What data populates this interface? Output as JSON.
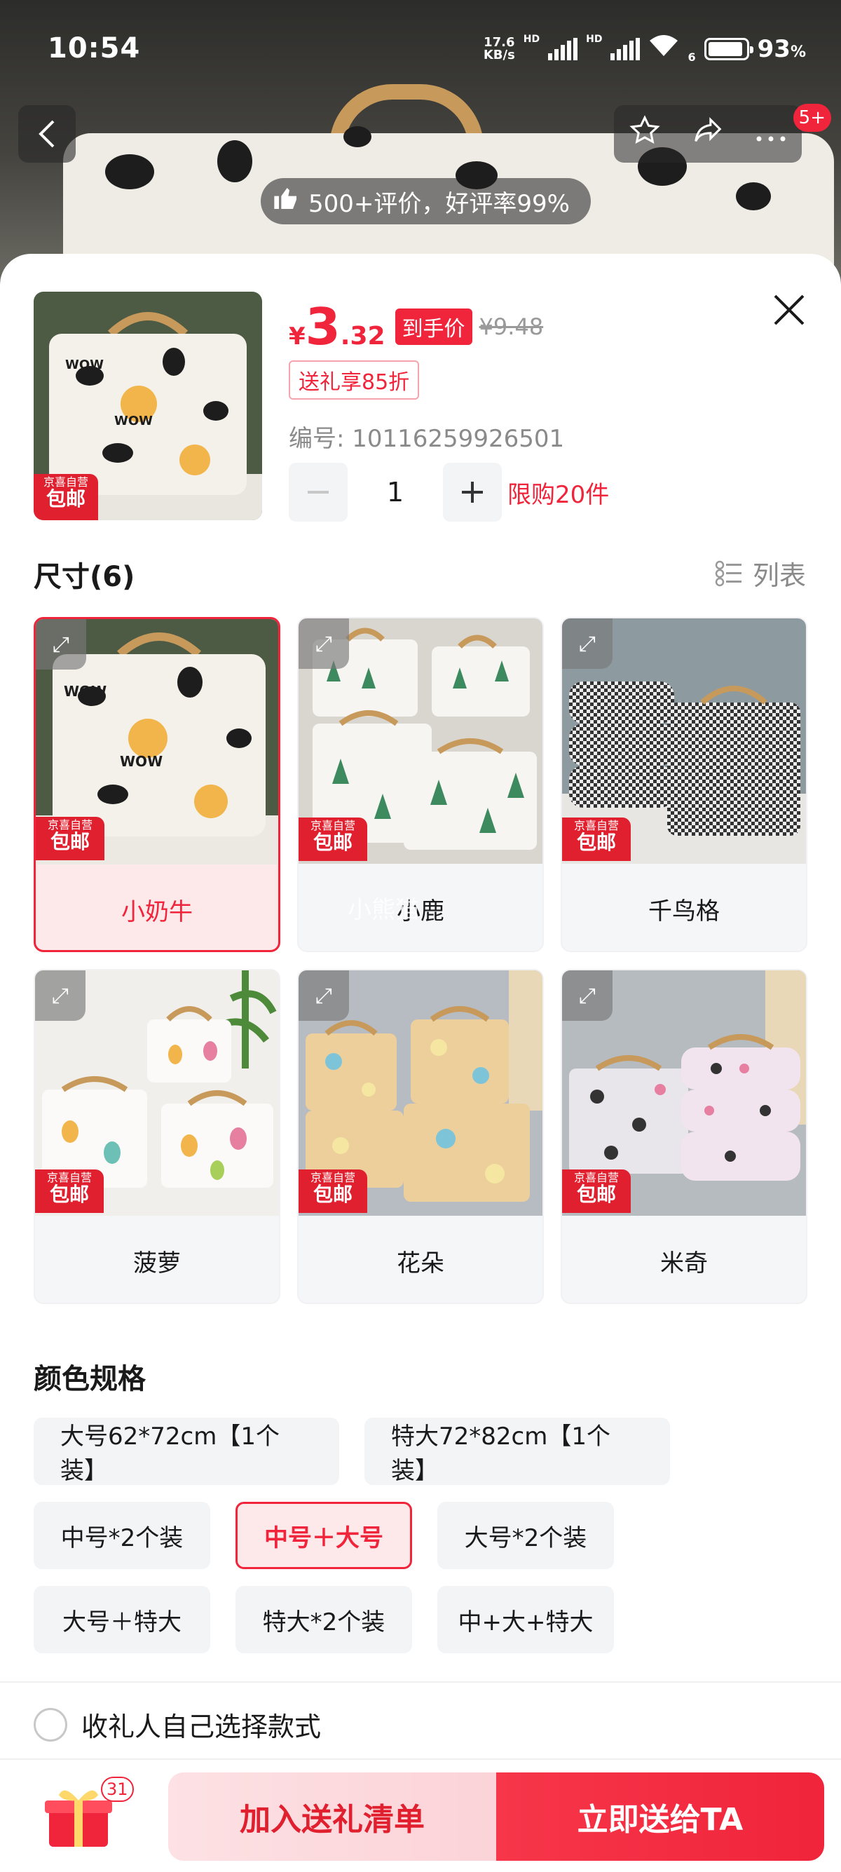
{
  "status_bar": {
    "time": "10:54",
    "net_speed_value": "17.6",
    "net_speed_unit": "KB/s",
    "hd1": "HD",
    "hd2": "HD",
    "wifi_label": "6",
    "battery_percent": "93",
    "battery_unit": "%",
    "battery_level": 0.93
  },
  "nav": {
    "back_icon": "chevron-left-icon",
    "favorite_icon": "star-icon",
    "share_icon": "share-icon",
    "more_icon": "more-icon",
    "more_badge": "5+"
  },
  "review_banner": {
    "text": "500+评价，好评率99%"
  },
  "product": {
    "price_currency": "¥",
    "price_integer": "3",
    "price_decimal": ".32",
    "final_price_tag": "到手价",
    "original_price": "¥9.48",
    "gift_discount": "送礼享85折",
    "sku_label": "编号: 10116259926501",
    "quantity": "1",
    "purchase_limit": "限购20件",
    "badge_line1": "京喜自营",
    "badge_line2": "包邮"
  },
  "size_section": {
    "title": "尺寸(6)",
    "list_toggle": "列表",
    "options": [
      {
        "label": "小奶牛",
        "selected": true,
        "watermark": ""
      },
      {
        "label": "小鹿",
        "selected": false,
        "watermark": "小熊猫"
      },
      {
        "label": "千鸟格",
        "selected": false,
        "watermark": ""
      },
      {
        "label": "菠萝",
        "selected": false,
        "watermark": ""
      },
      {
        "label": "花朵",
        "selected": false,
        "watermark": ""
      },
      {
        "label": "米奇",
        "selected": false,
        "watermark": ""
      }
    ]
  },
  "spec_section": {
    "title": "颜色规格",
    "options": [
      {
        "label": "大号62*72cm【1个装】",
        "selected": false
      },
      {
        "label": "特大72*82cm【1个装】",
        "selected": false
      },
      {
        "label": "中号*2个装",
        "selected": false
      },
      {
        "label": "中号＋大号",
        "selected": true
      },
      {
        "label": "大号*2个装",
        "selected": false
      },
      {
        "label": "大号＋特大",
        "selected": false
      },
      {
        "label": "特大*2个装",
        "selected": false
      },
      {
        "label": "中+大+特大",
        "selected": false
      }
    ]
  },
  "recipient_choice": {
    "label": "收礼人自己选择款式"
  },
  "bottom_bar": {
    "gift_count": "31",
    "add_button": "加入送礼清单",
    "send_button": "立即送给TA"
  },
  "colors": {
    "accent_red": "#f0243a",
    "selected_bg": "#fde8ea",
    "chip_bg": "#f3f4f6"
  }
}
